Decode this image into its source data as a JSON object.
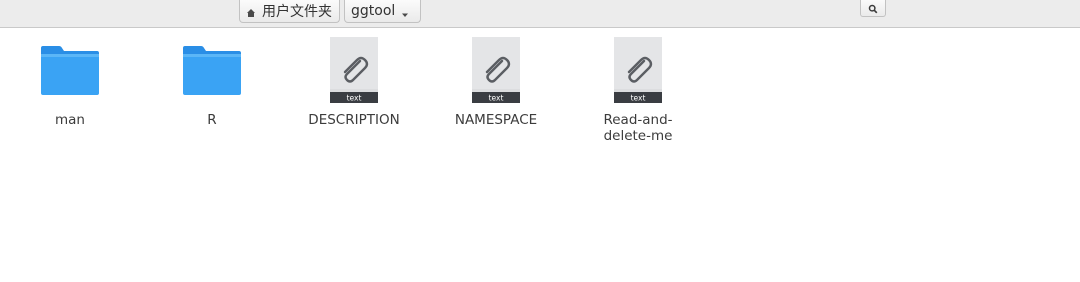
{
  "pathbar": {
    "home_label": "用户文件夹",
    "current_label": "ggtool"
  },
  "files": [
    {
      "label": "man",
      "type": "folder"
    },
    {
      "label": "R",
      "type": "folder"
    },
    {
      "label": "DESCRIPTION",
      "type": "text",
      "badge": "text"
    },
    {
      "label": "NAMESPACE",
      "type": "text",
      "badge": "text"
    },
    {
      "label": "Read-and-delete-me",
      "type": "text",
      "badge": "text"
    }
  ],
  "colors": {
    "folder_blue": "#3aa3f4",
    "doc_gray": "#dcdddf",
    "badge_dark": "#3a3d42"
  }
}
